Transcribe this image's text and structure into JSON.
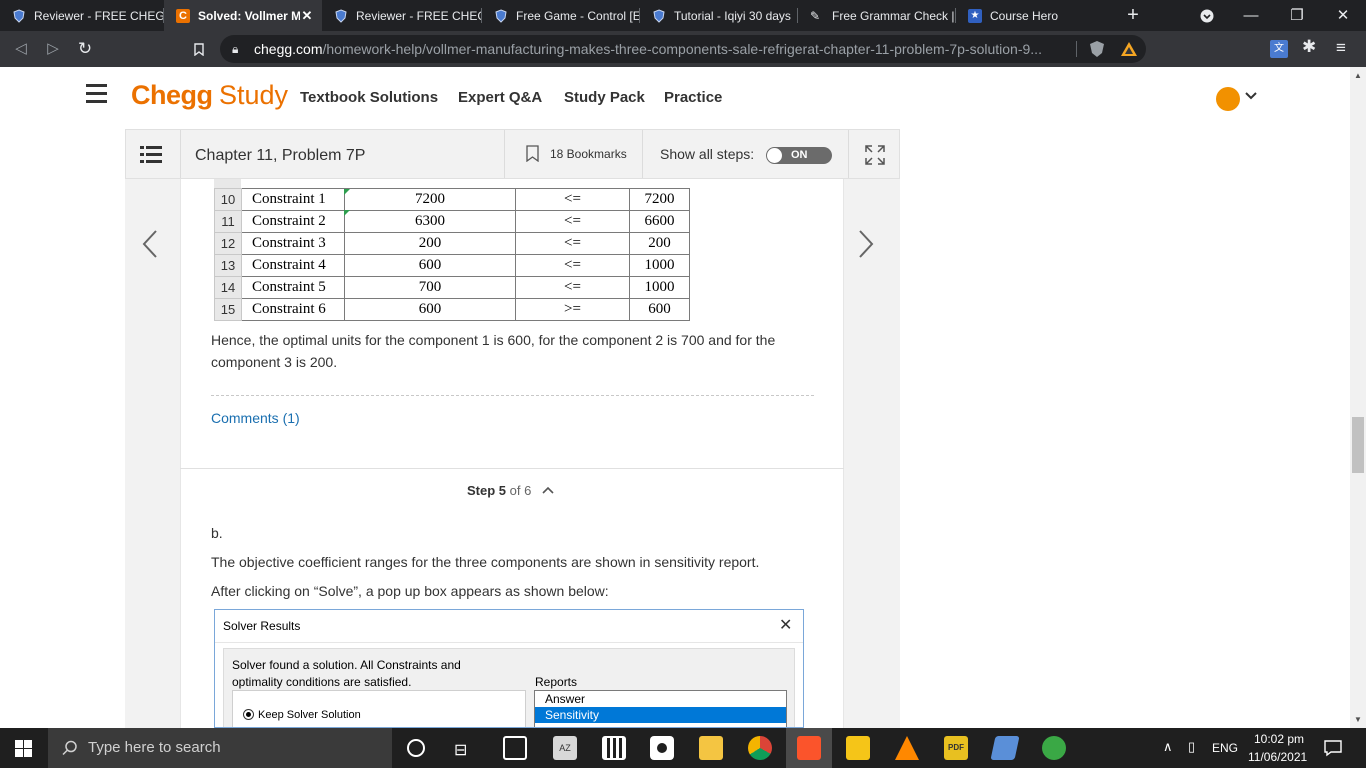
{
  "browser": {
    "tabs": [
      {
        "title": "Reviewer - FREE CHEGG",
        "active": false
      },
      {
        "title": "Solved: Vollmer Ma",
        "active": true
      },
      {
        "title": "Reviewer - FREE CHEGG",
        "active": false
      },
      {
        "title": "Free Game - Control [E",
        "active": false
      },
      {
        "title": "Tutorial - Iqiyi 30 days",
        "active": false
      },
      {
        "title": "Free Grammar Check |",
        "active": false
      },
      {
        "title": "Course Hero",
        "active": false
      }
    ],
    "new_tab": "+",
    "url_host": "chegg.com",
    "url_path": "/homework-help/vollmer-manufacturing-makes-three-components-sale-refrigerat-chapter-11-problem-7p-solution-9..."
  },
  "header": {
    "logo_chegg": "Chegg",
    "logo_study": "Study",
    "nav": [
      "Textbook Solutions",
      "Expert Q&A",
      "Study Pack",
      "Practice"
    ]
  },
  "problem_bar": {
    "title": "Chapter 11, Problem 7P",
    "bookmarks": "18 Bookmarks",
    "show_steps_label": "Show all steps:",
    "toggle_state": "ON"
  },
  "sheet": {
    "rows": [
      {
        "n": "10",
        "label": "Constraint 1",
        "lhs": "7200",
        "op": "<=",
        "rhs": "7200"
      },
      {
        "n": "11",
        "label": "Constraint 2",
        "lhs": "6300",
        "op": "<=",
        "rhs": "6600"
      },
      {
        "n": "12",
        "label": "Constraint 3",
        "lhs": "200",
        "op": "<=",
        "rhs": "200"
      },
      {
        "n": "13",
        "label": "Constraint 4",
        "lhs": "600",
        "op": "<=",
        "rhs": "1000"
      },
      {
        "n": "14",
        "label": "Constraint 5",
        "lhs": "700",
        "op": "<=",
        "rhs": "1000"
      },
      {
        "n": "15",
        "label": "Constraint 6",
        "lhs": "600",
        "op": ">=",
        "rhs": "600"
      }
    ]
  },
  "solution": {
    "conclusion_line1": "Hence, the optimal units for the component 1 is 600, for the component 2 is 700 and for the",
    "conclusion_line2": "component 3 is 200.",
    "comments": "Comments (1)",
    "step_label": "Step 5",
    "step_of": "of 6",
    "part": "b.",
    "para1": "The objective coefficient ranges for the three components are shown in sensitivity report.",
    "para2": "After clicking on “Solve”, a pop up box appears as shown below:"
  },
  "solver": {
    "title": "Solver Results",
    "message_line1": "Solver found a solution.  All Constraints and",
    "message_line2": "optimality conditions are satisfied.",
    "reports_label": "Reports",
    "reports": [
      "Answer",
      "Sensitivity"
    ],
    "keep_option": "Keep Solver Solution"
  },
  "taskbar": {
    "search_placeholder": "Type here to search",
    "language": "ENG",
    "time": "10:02 pm",
    "date": "11/06/2021"
  },
  "colors": {
    "chegg_orange": "#eb7100",
    "link_blue": "#1a6fb0",
    "selection_blue": "#0078d7"
  }
}
